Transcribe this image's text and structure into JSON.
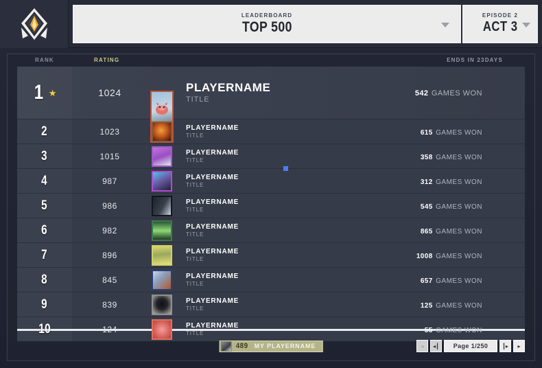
{
  "header": {
    "logo_icon": "rank-emblem-icon",
    "leaderboard_select": {
      "kicker": "LEADERBOARD",
      "value": "TOP 500",
      "caret_icon": "chevron-down-icon"
    },
    "act_select": {
      "kicker": "EPISODE 2",
      "value": "ACT 3",
      "caret_icon": "chevron-down-icon"
    }
  },
  "columns": {
    "rank": "RANK",
    "rating": "RATING",
    "ends_in": "ENDS IN 23DAYS"
  },
  "colors": {
    "rating_accent": "#cfc98a",
    "star": "#f2d432",
    "badge_bg": "#b3b488",
    "panel_bg": "#363b49",
    "cursor": "#4a7dfb"
  },
  "rows": [
    {
      "rank": "1",
      "star": "★",
      "rating": "1024",
      "name": "PLAYERNAME",
      "title": "TITLE",
      "games_won": "542",
      "games_won_label": "GAMES WON",
      "card_border": "#c0533e",
      "card_art_a": "#9fc3dd",
      "card_art_b": "#d9736e"
    },
    {
      "rank": "2",
      "rating": "1023",
      "name": "PLAYERNAME",
      "title": "TITLE",
      "games_won": "615",
      "games_won_label": "GAMES WON",
      "card_border": "#8a5a33",
      "card_art_a": "#e0842f",
      "card_art_b": "#3a1b10"
    },
    {
      "rank": "3",
      "rating": "1015",
      "name": "PLAYERNAME",
      "title": "TITLE",
      "games_won": "358",
      "games_won_label": "GAMES WON",
      "card_border": "#9d5bc8",
      "card_art_a": "#b96fd8",
      "card_art_b": "#dfe7f2"
    },
    {
      "rank": "4",
      "rating": "987",
      "name": "PLAYERNAME",
      "title": "TITLE",
      "games_won": "312",
      "games_won_label": "GAMES WON",
      "card_border": "#b04bd8",
      "card_art_a": "#4cc6e8",
      "card_art_b": "#2a2340"
    },
    {
      "rank": "5",
      "rating": "986",
      "name": "PLAYERNAME",
      "title": "TITLE",
      "games_won": "545",
      "games_won_label": "GAMES WON",
      "card_border": "#14161c",
      "card_art_a": "#2d3440",
      "card_art_b": "#c9d2dd"
    },
    {
      "rank": "6",
      "rating": "982",
      "name": "PLAYERNAME",
      "title": "TITLE",
      "games_won": "865",
      "games_won_label": "GAMES WON",
      "card_border": "#3f7a4a",
      "card_art_a": "#7fc96a",
      "card_art_b": "#1d3c24"
    },
    {
      "rank": "7",
      "rating": "896",
      "name": "PLAYERNAME",
      "title": "TITLE",
      "games_won": "1008",
      "games_won_label": "GAMES WON",
      "card_border": "#cfd36a",
      "card_art_a": "#e3e06a",
      "card_art_b": "#4d6a58"
    },
    {
      "rank": "8",
      "rating": "845",
      "name": "PLAYERNAME",
      "title": "TITLE",
      "games_won": "657",
      "games_won_label": "GAMES WON",
      "card_border": "#2a3f76",
      "card_art_a": "#cbd6e6",
      "card_art_b": "#b4552f"
    },
    {
      "rank": "9",
      "rating": "839",
      "name": "PLAYERNAME",
      "title": "TITLE",
      "games_won": "125",
      "games_won_label": "GAMES WON",
      "card_border": "#8d8f93",
      "card_art_a": "#1a1c22",
      "card_art_b": "#b8b3a6"
    },
    {
      "rank": "10",
      "rating": "124",
      "name": "PLAYERNAME",
      "title": "TITLE",
      "games_won": "55",
      "games_won_label": "GAMES WON",
      "card_border": "#e0705f",
      "card_art_a": "#e98f94",
      "card_art_b": "#c9544f"
    }
  ],
  "footer": {
    "my_rank": "489",
    "my_player_label": "MY PLAYERNAME",
    "pager": {
      "prev_icon": "◂",
      "first_icon": "◂┃",
      "page_label": "Page 1/250",
      "last_icon": "┃▸",
      "next_icon": "▸"
    }
  }
}
